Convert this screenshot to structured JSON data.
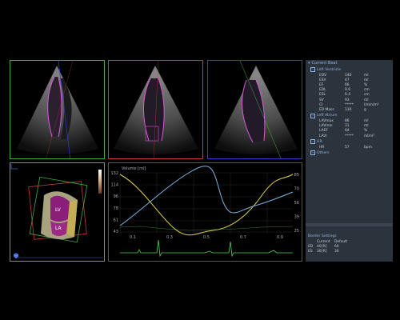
{
  "views": [
    {
      "name": "apical-view-green",
      "border": "#3fae3f"
    },
    {
      "name": "apical-view-red",
      "border": "#c83a3a"
    },
    {
      "name": "apical-view-blue",
      "border": "#3a3ac8"
    }
  ],
  "render3d": {
    "lv_label": "LV",
    "la_label": "LA"
  },
  "graph": {
    "title": "Volume [ml]",
    "y_left_ticks": [
      "132",
      "114",
      "96",
      "78",
      "61",
      "43"
    ],
    "y_right_ticks": [
      "85",
      "70",
      "56",
      "39",
      "25"
    ],
    "x_ticks": [
      "0.1",
      "0.3",
      "0.5",
      "0.7",
      "0.9"
    ]
  },
  "panel": {
    "title": "Current Beat",
    "left_ventricle": {
      "label": "Left Ventricle",
      "rows": [
        {
          "k": "EDV",
          "v": "140",
          "u": "ml"
        },
        {
          "k": "ESV",
          "v": "47",
          "u": "ml"
        },
        {
          "k": "EF",
          "v": "66",
          "u": "%"
        },
        {
          "k": "EDL",
          "v": "9.6",
          "u": "cm"
        },
        {
          "k": "ESL",
          "v": "6.4",
          "u": "cm"
        },
        {
          "k": "SV",
          "v": "93",
          "u": "ml"
        },
        {
          "k": "CI",
          "v": "*****",
          "u": "l/min/m²"
        },
        {
          "k": "ED Mass",
          "v": "130",
          "u": "g"
        }
      ]
    },
    "left_atrium": {
      "label": "Left Atrium",
      "rows": [
        {
          "k": "LAVmax",
          "v": "86",
          "u": "ml"
        },
        {
          "k": "LAVmin",
          "v": "31",
          "u": "ml"
        },
        {
          "k": "LAEF",
          "v": "64",
          "u": "%"
        },
        {
          "k": "LAVI",
          "v": "*****",
          "u": "ml/m²"
        }
      ]
    },
    "hr": {
      "label": "HR",
      "rows": [
        {
          "k": "HR",
          "v": "57",
          "u": "bpm"
        }
      ]
    },
    "others_label": "Others"
  },
  "border_settings": {
    "title": "Border Settings",
    "headers": [
      "Current",
      "Default"
    ],
    "rows": [
      {
        "k": "ED",
        "cur": "40",
        "bracket": "[R]",
        "def": "60"
      },
      {
        "k": "ES",
        "cur": "30",
        "bracket": "[R]",
        "def": "30"
      }
    ]
  },
  "colors": {
    "yellow_curve": "#e0d24a",
    "blue_curve": "#7fb3e0",
    "ecg": "#4bd64b",
    "panel_bg": "#2b333c"
  }
}
